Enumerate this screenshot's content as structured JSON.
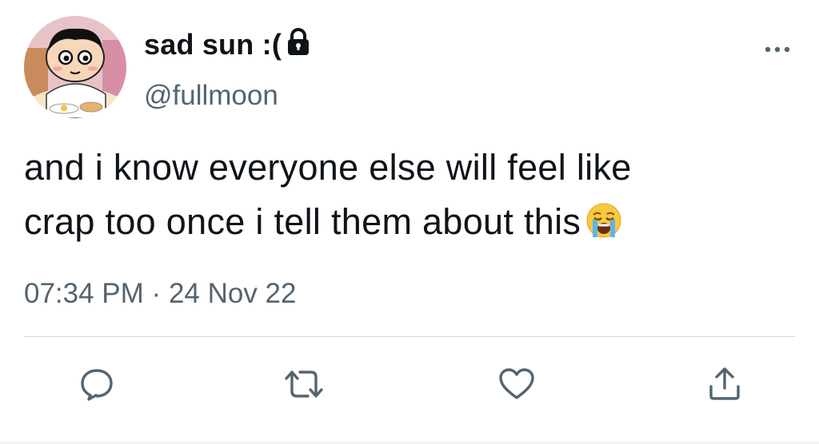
{
  "author": {
    "display_name": "sad sun :(",
    "handle": "@fullmoon",
    "protected_icon": "lock-icon",
    "avatar_icon": "cartoon-avatar"
  },
  "tweet": {
    "lines": [
      "and i know everyone else will feel like",
      "crap too once i tell them about this"
    ],
    "emoji": "loudly-crying-face"
  },
  "meta": {
    "time": "07:34 PM",
    "separator": "·",
    "date": "24 Nov 22"
  },
  "actions": {
    "reply": "reply-icon",
    "retweet": "retweet-icon",
    "like": "heart-icon",
    "share": "share-icon",
    "more": "more-icon"
  },
  "colors": {
    "text": "#0f1419",
    "secondary": "#536471",
    "divider": "#cfd9de"
  }
}
